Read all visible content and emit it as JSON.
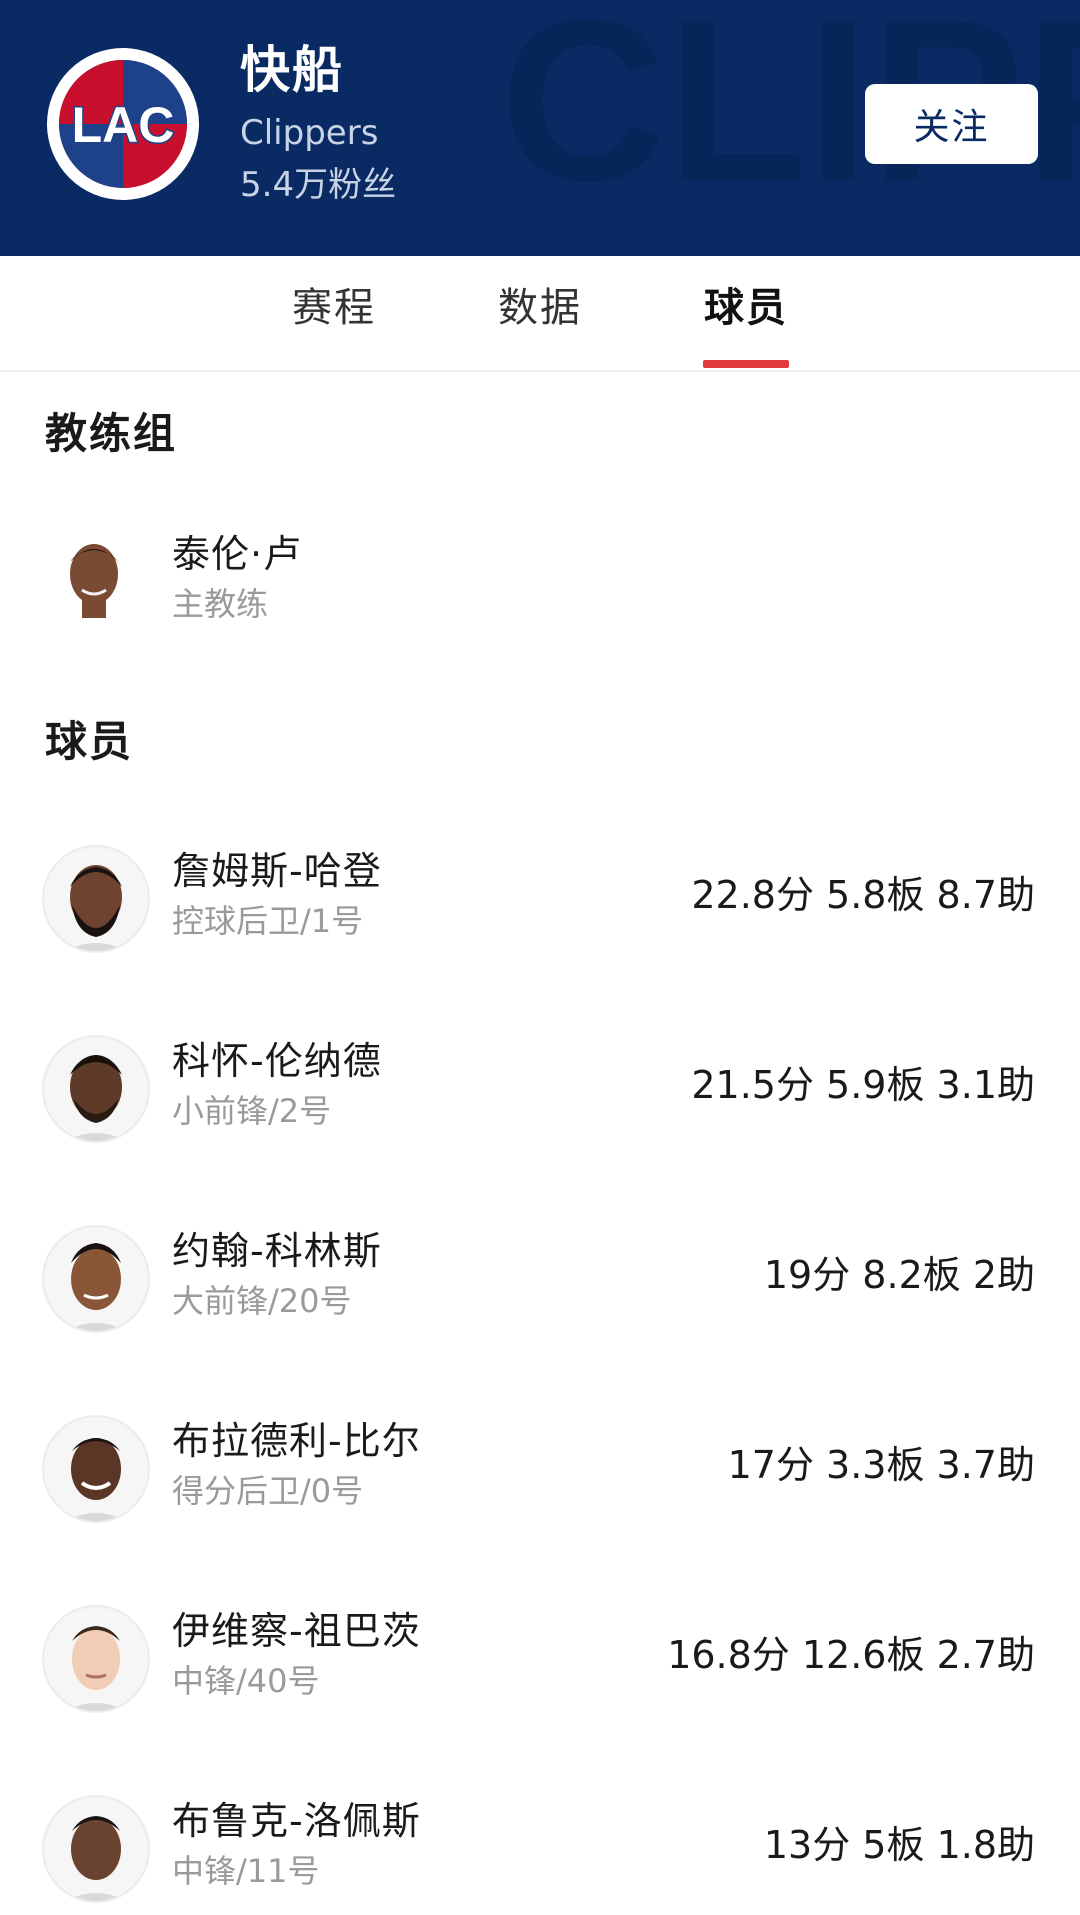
{
  "header": {
    "team_name": "快船",
    "team_name_en": "Clippers",
    "fans": "5.4万粉丝",
    "follow_label": "关注",
    "logo_text": "LAC",
    "watermark_text": "CLIPPERS",
    "bg_color": "#0a2a63"
  },
  "tabs": [
    {
      "label": "赛程",
      "active": false
    },
    {
      "label": "数据",
      "active": false
    },
    {
      "label": "球员",
      "active": true
    }
  ],
  "accent_color": "#e23b3b",
  "coaches": {
    "title": "教练组",
    "items": [
      {
        "name": "泰伦·卢",
        "role": "主教练"
      }
    ]
  },
  "players": {
    "title": "球员",
    "items": [
      {
        "name": "詹姆斯-哈登",
        "role": "控球后卫/1号",
        "stats": "22.8分 5.8板 8.7助"
      },
      {
        "name": "科怀-伦纳德",
        "role": "小前锋/2号",
        "stats": "21.5分 5.9板 3.1助"
      },
      {
        "name": "约翰-科林斯",
        "role": "大前锋/20号",
        "stats": "19分 8.2板 2助"
      },
      {
        "name": "布拉德利-比尔",
        "role": "得分后卫/0号",
        "stats": "17分 3.3板 3.7助"
      },
      {
        "name": "伊维察-祖巴茨",
        "role": "中锋/40号",
        "stats": "16.8分 12.6板 2.7助"
      },
      {
        "name": "布鲁克-洛佩斯",
        "role": "中锋/11号",
        "stats": "13分 5板 1.8助"
      }
    ]
  }
}
